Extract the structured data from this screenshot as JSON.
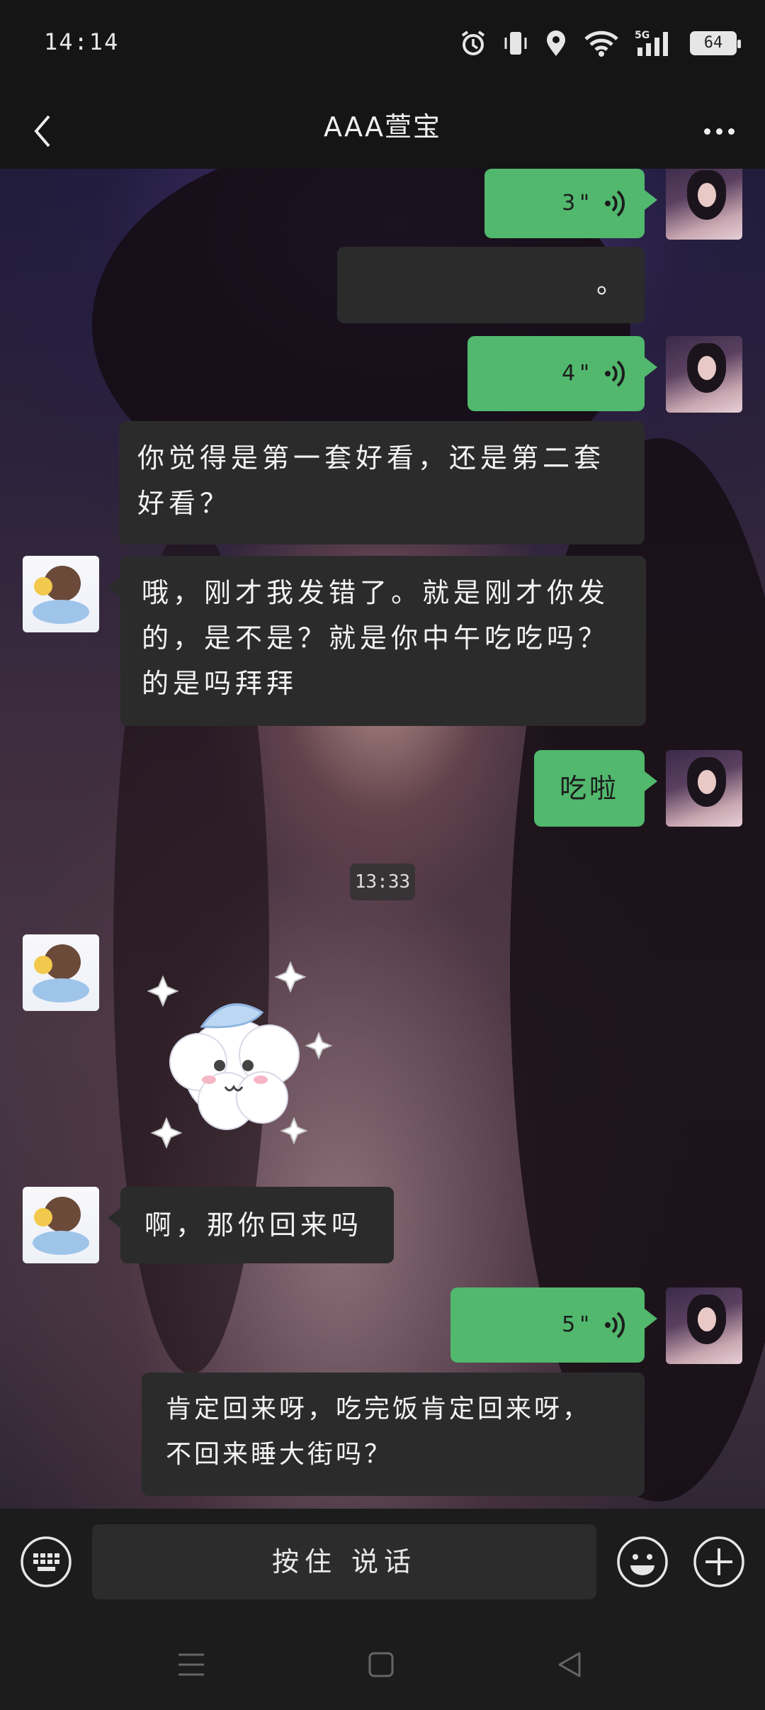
{
  "status_bar": {
    "time": "14:14",
    "network": "5G",
    "battery": "64"
  },
  "nav": {
    "title": "AAA萱宝",
    "back_icon": "chevron-left-icon",
    "more_icon": "more-dots-icon"
  },
  "messages": [
    {
      "side": "right",
      "type": "voice",
      "duration": "3\""
    },
    {
      "side": "left",
      "type": "text",
      "text": "。"
    },
    {
      "side": "right",
      "type": "voice",
      "duration": "4\""
    },
    {
      "side": "left",
      "type": "text",
      "lines": [
        "你觉得是第一套好看，还是第二套",
        "好看？"
      ]
    },
    {
      "side": "left",
      "type": "text",
      "lines": [
        "哦，刚才我发错了。就是刚才你发",
        "的，是不是？就是你中午吃吃吗？",
        "的是吗拜拜"
      ]
    },
    {
      "side": "right",
      "type": "text",
      "text": "吃啦"
    },
    {
      "side": "left",
      "type": "sticker",
      "icon": "cloud-sticker-icon"
    },
    {
      "side": "left",
      "type": "text",
      "text": "啊，那你回来吗"
    },
    {
      "side": "right",
      "type": "voice",
      "duration": "5\""
    },
    {
      "side": "left",
      "type": "text",
      "lines": [
        "肯定回来呀，吃完饭肯定回来呀，",
        "不回来睡大街吗？"
      ]
    }
  ],
  "timestamp": "13:33",
  "input": {
    "hold_to_talk": "按住 说话",
    "keyboard_icon": "keyboard-icon",
    "emoji_icon": "emoji-icon",
    "plus_icon": "plus-icon"
  },
  "system_nav": {
    "menu_icon": "menu-icon",
    "home_icon": "home-icon",
    "back_icon": "back-triangle-icon"
  },
  "colors": {
    "green_bubble": "#51b86d",
    "dark_bubble": "#2b2b2b",
    "bar_bg": "#1c1c1c"
  }
}
